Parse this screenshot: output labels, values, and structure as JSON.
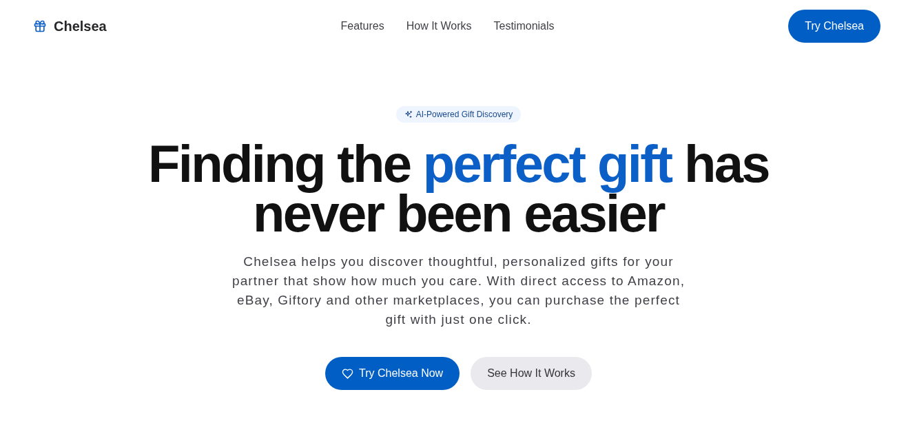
{
  "nav": {
    "brand": "Chelsea",
    "links": [
      "Features",
      "How It Works",
      "Testimonials"
    ],
    "cta": "Try Chelsea"
  },
  "hero": {
    "badge": "AI-Powered Gift Discovery",
    "headline": {
      "before": "Finding the",
      "highlight": "perfect gift",
      "after": "has never been easier"
    },
    "description": "Chelsea helps you discover thoughtful, personalized gifts for your partner that show how much you care. With direct access to Amazon, eBay, Giftory and other marketplaces, you can purchase the perfect gift with just one click.",
    "buttons": [
      {
        "label": "Try Chelsea Now",
        "kind": "primary"
      },
      {
        "label": "See How It Works",
        "kind": "secondary"
      }
    ]
  }
}
